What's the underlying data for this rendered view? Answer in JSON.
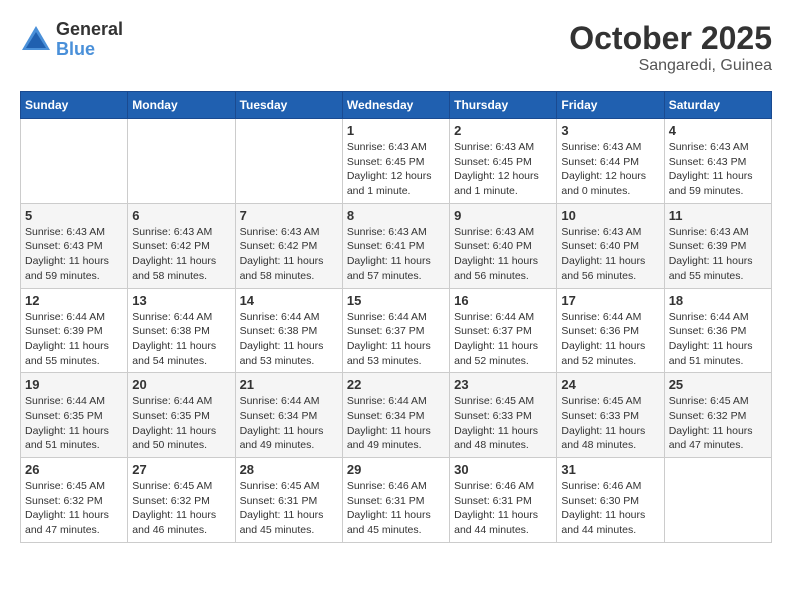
{
  "header": {
    "logo_general": "General",
    "logo_blue": "Blue",
    "month": "October 2025",
    "location": "Sangaredi, Guinea"
  },
  "weekdays": [
    "Sunday",
    "Monday",
    "Tuesday",
    "Wednesday",
    "Thursday",
    "Friday",
    "Saturday"
  ],
  "weeks": [
    [
      {
        "day": "",
        "info": ""
      },
      {
        "day": "",
        "info": ""
      },
      {
        "day": "",
        "info": ""
      },
      {
        "day": "1",
        "info": "Sunrise: 6:43 AM\nSunset: 6:45 PM\nDaylight: 12 hours\nand 1 minute."
      },
      {
        "day": "2",
        "info": "Sunrise: 6:43 AM\nSunset: 6:45 PM\nDaylight: 12 hours\nand 1 minute."
      },
      {
        "day": "3",
        "info": "Sunrise: 6:43 AM\nSunset: 6:44 PM\nDaylight: 12 hours\nand 0 minutes."
      },
      {
        "day": "4",
        "info": "Sunrise: 6:43 AM\nSunset: 6:43 PM\nDaylight: 11 hours\nand 59 minutes."
      }
    ],
    [
      {
        "day": "5",
        "info": "Sunrise: 6:43 AM\nSunset: 6:43 PM\nDaylight: 11 hours\nand 59 minutes."
      },
      {
        "day": "6",
        "info": "Sunrise: 6:43 AM\nSunset: 6:42 PM\nDaylight: 11 hours\nand 58 minutes."
      },
      {
        "day": "7",
        "info": "Sunrise: 6:43 AM\nSunset: 6:42 PM\nDaylight: 11 hours\nand 58 minutes."
      },
      {
        "day": "8",
        "info": "Sunrise: 6:43 AM\nSunset: 6:41 PM\nDaylight: 11 hours\nand 57 minutes."
      },
      {
        "day": "9",
        "info": "Sunrise: 6:43 AM\nSunset: 6:40 PM\nDaylight: 11 hours\nand 56 minutes."
      },
      {
        "day": "10",
        "info": "Sunrise: 6:43 AM\nSunset: 6:40 PM\nDaylight: 11 hours\nand 56 minutes."
      },
      {
        "day": "11",
        "info": "Sunrise: 6:43 AM\nSunset: 6:39 PM\nDaylight: 11 hours\nand 55 minutes."
      }
    ],
    [
      {
        "day": "12",
        "info": "Sunrise: 6:44 AM\nSunset: 6:39 PM\nDaylight: 11 hours\nand 55 minutes."
      },
      {
        "day": "13",
        "info": "Sunrise: 6:44 AM\nSunset: 6:38 PM\nDaylight: 11 hours\nand 54 minutes."
      },
      {
        "day": "14",
        "info": "Sunrise: 6:44 AM\nSunset: 6:38 PM\nDaylight: 11 hours\nand 53 minutes."
      },
      {
        "day": "15",
        "info": "Sunrise: 6:44 AM\nSunset: 6:37 PM\nDaylight: 11 hours\nand 53 minutes."
      },
      {
        "day": "16",
        "info": "Sunrise: 6:44 AM\nSunset: 6:37 PM\nDaylight: 11 hours\nand 52 minutes."
      },
      {
        "day": "17",
        "info": "Sunrise: 6:44 AM\nSunset: 6:36 PM\nDaylight: 11 hours\nand 52 minutes."
      },
      {
        "day": "18",
        "info": "Sunrise: 6:44 AM\nSunset: 6:36 PM\nDaylight: 11 hours\nand 51 minutes."
      }
    ],
    [
      {
        "day": "19",
        "info": "Sunrise: 6:44 AM\nSunset: 6:35 PM\nDaylight: 11 hours\nand 51 minutes."
      },
      {
        "day": "20",
        "info": "Sunrise: 6:44 AM\nSunset: 6:35 PM\nDaylight: 11 hours\nand 50 minutes."
      },
      {
        "day": "21",
        "info": "Sunrise: 6:44 AM\nSunset: 6:34 PM\nDaylight: 11 hours\nand 49 minutes."
      },
      {
        "day": "22",
        "info": "Sunrise: 6:44 AM\nSunset: 6:34 PM\nDaylight: 11 hours\nand 49 minutes."
      },
      {
        "day": "23",
        "info": "Sunrise: 6:45 AM\nSunset: 6:33 PM\nDaylight: 11 hours\nand 48 minutes."
      },
      {
        "day": "24",
        "info": "Sunrise: 6:45 AM\nSunset: 6:33 PM\nDaylight: 11 hours\nand 48 minutes."
      },
      {
        "day": "25",
        "info": "Sunrise: 6:45 AM\nSunset: 6:32 PM\nDaylight: 11 hours\nand 47 minutes."
      }
    ],
    [
      {
        "day": "26",
        "info": "Sunrise: 6:45 AM\nSunset: 6:32 PM\nDaylight: 11 hours\nand 47 minutes."
      },
      {
        "day": "27",
        "info": "Sunrise: 6:45 AM\nSunset: 6:32 PM\nDaylight: 11 hours\nand 46 minutes."
      },
      {
        "day": "28",
        "info": "Sunrise: 6:45 AM\nSunset: 6:31 PM\nDaylight: 11 hours\nand 45 minutes."
      },
      {
        "day": "29",
        "info": "Sunrise: 6:46 AM\nSunset: 6:31 PM\nDaylight: 11 hours\nand 45 minutes."
      },
      {
        "day": "30",
        "info": "Sunrise: 6:46 AM\nSunset: 6:31 PM\nDaylight: 11 hours\nand 44 minutes."
      },
      {
        "day": "31",
        "info": "Sunrise: 6:46 AM\nSunset: 6:30 PM\nDaylight: 11 hours\nand 44 minutes."
      },
      {
        "day": "",
        "info": ""
      }
    ]
  ]
}
